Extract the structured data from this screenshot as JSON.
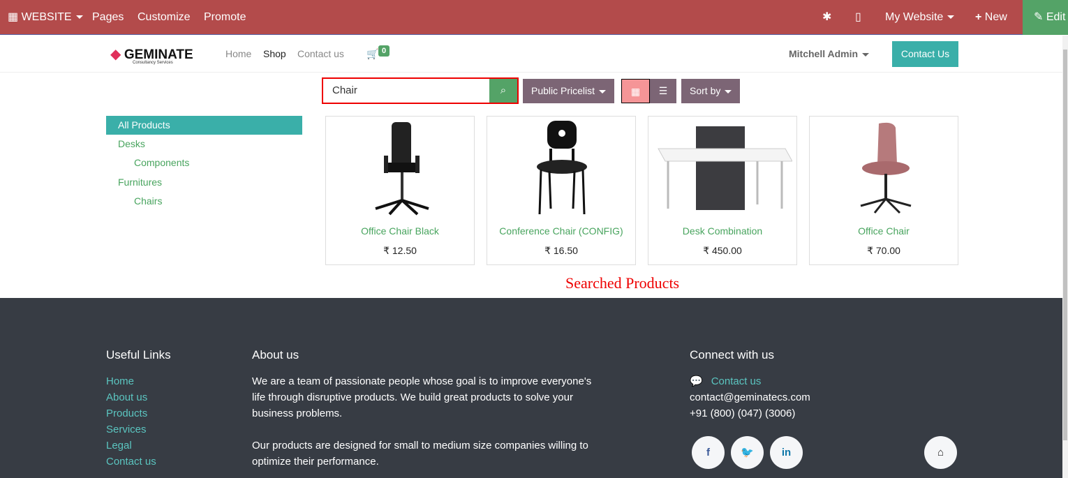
{
  "topbar": {
    "apps": "WEBSITE",
    "pages": "Pages",
    "customize": "Customize",
    "promote": "Promote",
    "website": "My Website",
    "new": "New",
    "edit": "Edit"
  },
  "nav": {
    "logo": "GEMINATE",
    "logo_sub": "Consultancy Services",
    "home": "Home",
    "shop": "Shop",
    "contact": "Contact us",
    "cart_count": "0",
    "user": "Mitchell Admin",
    "contact_btn": "Contact Us"
  },
  "search": {
    "value": "Chair",
    "pricelist": "Public Pricelist",
    "sort": "Sort by"
  },
  "categories": [
    "All Products",
    "Desks",
    "Components",
    "Furnitures",
    "Chairs"
  ],
  "products": [
    {
      "name": "Office Chair Black",
      "price": "₹ 12.50"
    },
    {
      "name": "Conference Chair (CONFIG)",
      "price": "₹ 16.50"
    },
    {
      "name": "Desk Combination",
      "price": "₹ 450.00"
    },
    {
      "name": "Office Chair",
      "price": "₹ 70.00"
    }
  ],
  "annotation": "Searched Products",
  "footer": {
    "links_title": "Useful Links",
    "links": [
      "Home",
      "About us",
      "Products",
      "Services",
      "Legal",
      "Contact us"
    ],
    "about_title": "About us",
    "about_p1": "We are a team of passionate people whose goal is to improve everyone's life through disruptive products. We build great products to solve your business problems.",
    "about_p2": "Our products are designed for small to medium size companies willing to optimize their performance.",
    "connect_title": "Connect with us",
    "contact_link": "Contact us",
    "email": "contact@geminatecs.com",
    "phone": "+91 (800) (047) (3006)"
  }
}
